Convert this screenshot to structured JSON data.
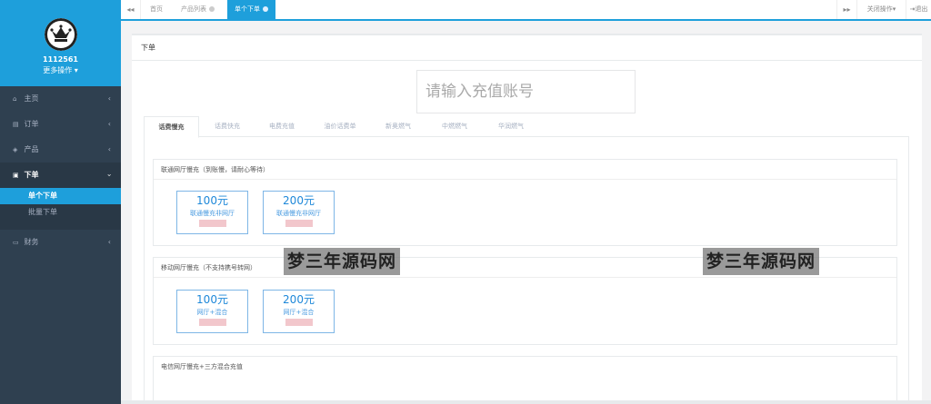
{
  "sidebar": {
    "user_id": "1112561",
    "more_ops": "更多操作",
    "items": [
      {
        "label": "主页",
        "icon": "home-icon"
      },
      {
        "label": "订单",
        "icon": "order-icon"
      },
      {
        "label": "产品",
        "icon": "product-icon"
      },
      {
        "label": "下单",
        "icon": "place-order-icon"
      },
      {
        "label": "财务",
        "icon": "finance-icon"
      }
    ],
    "submenu": [
      {
        "label": "单个下单"
      },
      {
        "label": "批量下单"
      }
    ]
  },
  "topbar": {
    "tabs": [
      {
        "label": "首页"
      },
      {
        "label": "产品列表"
      },
      {
        "label": "单个下单"
      }
    ],
    "close_ops": "关闭操作",
    "logout": "退出"
  },
  "panel": {
    "title": "下单",
    "account_placeholder": "请输入充值账号",
    "tabs": [
      {
        "label": "话费慢充"
      },
      {
        "label": "话费快充"
      },
      {
        "label": "电费充值"
      },
      {
        "label": "油价话费单"
      },
      {
        "label": "新奥燃气"
      },
      {
        "label": "中燃燃气"
      },
      {
        "label": "华润燃气"
      }
    ],
    "sections": [
      {
        "title": "联通网厅慢充（到账慢，请耐心等待）",
        "products": [
          {
            "price": "100元",
            "name": "联通慢充非网厅"
          },
          {
            "price": "200元",
            "name": "联通慢充非网厅"
          }
        ]
      },
      {
        "title": "移动网厅慢充（不支持携号转网）",
        "products": [
          {
            "price": "100元",
            "name": "网厅+混合"
          },
          {
            "price": "200元",
            "name": "网厅+混合"
          }
        ]
      },
      {
        "title": "电信网厅慢充+三方混合充值",
        "products": []
      }
    ]
  },
  "watermark": {
    "text": "梦三年源码网"
  },
  "colors": {
    "accent": "#1e9fdb",
    "sidebar_bg": "#2f4050"
  }
}
